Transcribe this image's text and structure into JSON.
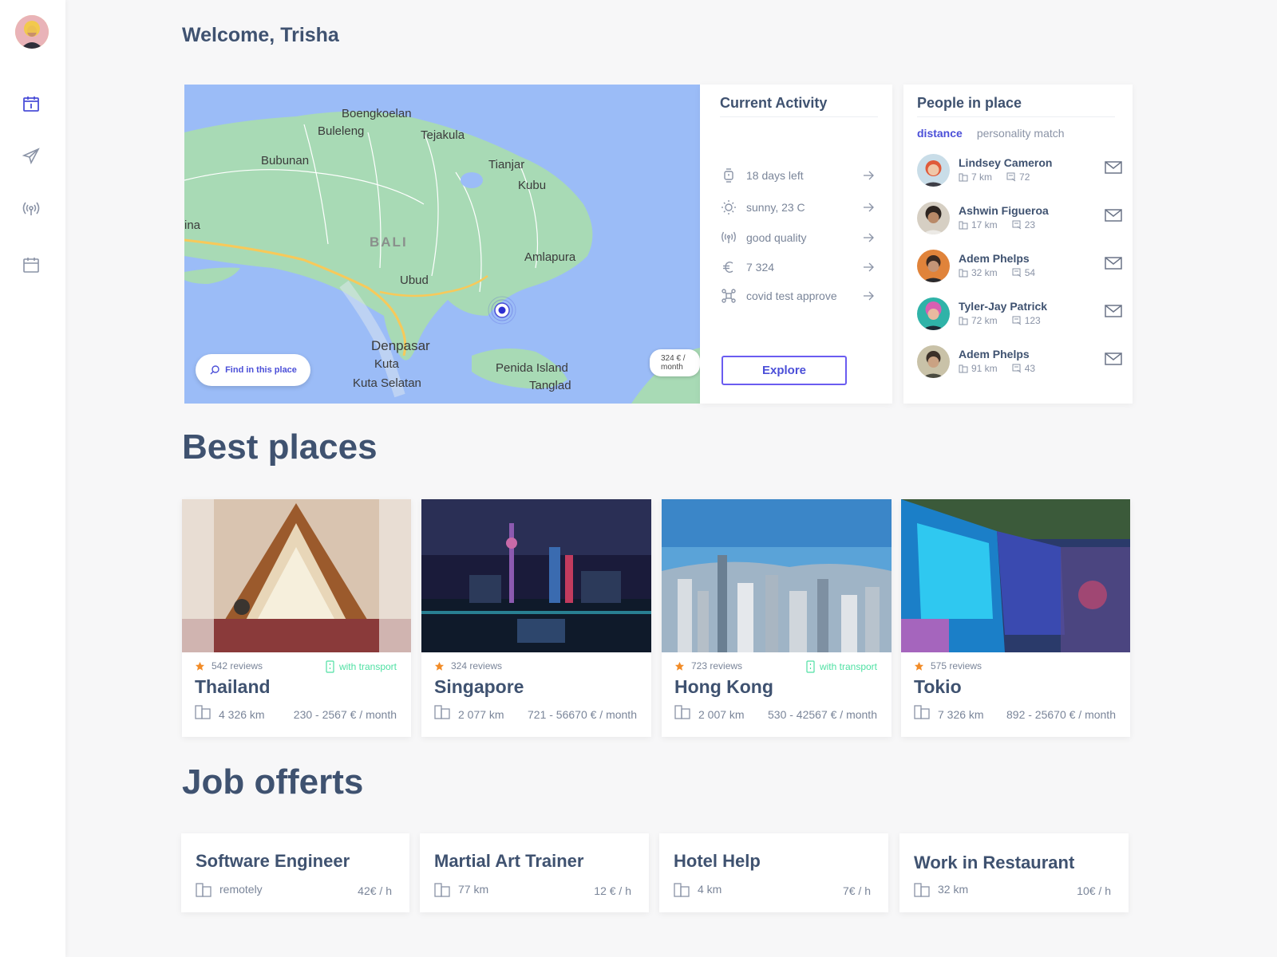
{
  "user": {
    "greeting": "Welcome, Trisha"
  },
  "sidebar": {
    "items": [
      {
        "icon": "calendar-today-icon",
        "active": true
      },
      {
        "icon": "send-icon",
        "active": false
      },
      {
        "icon": "broadcast-icon",
        "active": false
      },
      {
        "icon": "calendar-icon",
        "active": false
      }
    ]
  },
  "map": {
    "towns": [
      "Boengkoelan",
      "Buleleng",
      "Tejakula",
      "Bubunan",
      "Tianjar",
      "Kubu",
      "ina",
      "BALI",
      "Amlapura",
      "Ubud",
      "Denpasar",
      "Kuta",
      "Kuta Selatan",
      "Penida Island",
      "Tanglad"
    ],
    "price_pill": "324 € / month",
    "find_button": "Find in this place"
  },
  "activity": {
    "title": "Current Activity",
    "rows": [
      {
        "icon": "watch-icon",
        "label": "18 days left"
      },
      {
        "icon": "sun-icon",
        "label": "sunny, 23 C"
      },
      {
        "icon": "signal-icon",
        "label": "good quality"
      },
      {
        "icon": "euro-icon",
        "label": "7 324"
      },
      {
        "icon": "nodes-icon",
        "label": "covid test approve"
      }
    ],
    "explore_label": "Explore"
  },
  "people": {
    "title": "People in place",
    "tabs": [
      "distance",
      "personality match"
    ],
    "list": [
      {
        "name": "Lindsey Cameron",
        "distance": "7 km",
        "score": "72"
      },
      {
        "name": "Ashwin Figueroa",
        "distance": "17 km",
        "score": "23"
      },
      {
        "name": "Adem Phelps",
        "distance": "32 km",
        "score": "54"
      },
      {
        "name": "Tyler-Jay Patrick",
        "distance": "72 km",
        "score": "123"
      },
      {
        "name": "Adem Phelps",
        "distance": "91 km",
        "score": "43"
      }
    ]
  },
  "best_places": {
    "title": "Best places",
    "cards": [
      {
        "name": "Thailand",
        "reviews": "542 reviews",
        "transport": "with transport",
        "distance": "4 326 km",
        "price": "230 - 2567 € / month"
      },
      {
        "name": "Singapore",
        "reviews": "324 reviews",
        "transport": "",
        "distance": "2 077 km",
        "price": "721 - 56670 € / month"
      },
      {
        "name": "Hong Kong",
        "reviews": "723 reviews",
        "transport": "with transport",
        "distance": "2 007 km",
        "price": "530 - 42567 € / month"
      },
      {
        "name": "Tokio",
        "reviews": "575 reviews",
        "transport": "",
        "distance": "7 326 km",
        "price": "892 - 25670 € / month"
      }
    ]
  },
  "jobs": {
    "title": "Job offerts",
    "cards": [
      {
        "title": "Software Engineer",
        "location": "remotely",
        "rate": "42€ / h"
      },
      {
        "title": "Martial Art Trainer",
        "location": "77 km",
        "rate": "12 € / h"
      },
      {
        "title": "Hotel Help",
        "location": "4 km",
        "rate": "7€ / h"
      },
      {
        "title": "Work in Restaurant",
        "location": "32 km",
        "rate": "10€ / h"
      }
    ]
  },
  "colors": {
    "accent": "#4b4fd8",
    "transport": "#4fe0a3",
    "star": "#f28c28",
    "title": "#3f5270"
  }
}
